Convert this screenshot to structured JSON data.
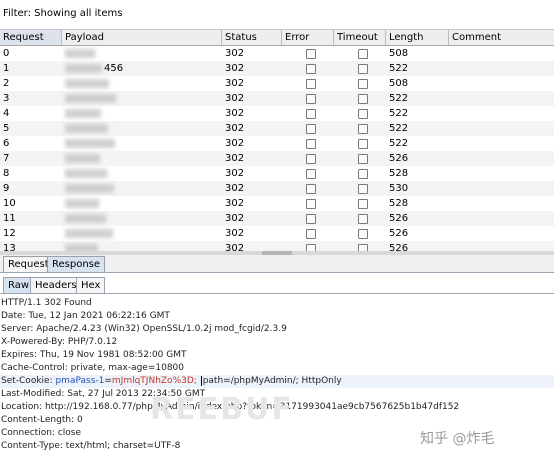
{
  "filter": {
    "label": "Filter: Showing all items"
  },
  "table": {
    "columns": [
      "Request",
      "Payload",
      "Status",
      "Error",
      "Timeout",
      "Length",
      "Comment"
    ],
    "rows": [
      {
        "request": "0",
        "payload": "",
        "status": "302",
        "length": "508",
        "error": false,
        "timeout": false
      },
      {
        "request": "1",
        "payload": "456",
        "status": "302",
        "length": "522",
        "error": false,
        "timeout": false
      },
      {
        "request": "2",
        "payload": "",
        "status": "302",
        "length": "508",
        "error": false,
        "timeout": false
      },
      {
        "request": "3",
        "payload": "",
        "status": "302",
        "length": "522",
        "error": false,
        "timeout": false
      },
      {
        "request": "4",
        "payload": "",
        "status": "302",
        "length": "522",
        "error": false,
        "timeout": false
      },
      {
        "request": "5",
        "payload": "",
        "status": "302",
        "length": "522",
        "error": false,
        "timeout": false
      },
      {
        "request": "6",
        "payload": "",
        "status": "302",
        "length": "522",
        "error": false,
        "timeout": false
      },
      {
        "request": "7",
        "payload": "",
        "status": "302",
        "length": "526",
        "error": false,
        "timeout": false
      },
      {
        "request": "8",
        "payload": "",
        "status": "302",
        "length": "528",
        "error": false,
        "timeout": false
      },
      {
        "request": "9",
        "payload": "",
        "status": "302",
        "length": "530",
        "error": false,
        "timeout": false
      },
      {
        "request": "10",
        "payload": "",
        "status": "302",
        "length": "528",
        "error": false,
        "timeout": false
      },
      {
        "request": "11",
        "payload": "",
        "status": "302",
        "length": "526",
        "error": false,
        "timeout": false
      },
      {
        "request": "12",
        "payload": "",
        "status": "302",
        "length": "526",
        "error": false,
        "timeout": false
      },
      {
        "request": "13",
        "payload": "",
        "status": "302",
        "length": "526",
        "error": false,
        "timeout": false
      }
    ]
  },
  "tabs": {
    "request": "Request",
    "response": "Response"
  },
  "subtabs": {
    "raw": "Raw",
    "headers": "Headers",
    "hex": "Hex"
  },
  "response": {
    "lines": [
      "HTTP/1.1 302 Found",
      "Date: Tue, 12 Jan 2021 06:22:16 GMT",
      "Server: Apache/2.4.23 (Win32) OpenSSL/1.0.2j mod_fcgid/2.3.9",
      "X-Powered-By: PHP/7.0.12",
      "Expires: Thu, 19 Nov 1981 08:52:00 GMT",
      "Cache-Control: private, max-age=10800"
    ],
    "cookie": {
      "prefix": "Set-Cookie: ",
      "name": "pmaPass-1",
      "eq": "=",
      "value": "mJmlqTJNhZo%3D;",
      "suffix": "path=/phpMyAdmin/; HttpOnly"
    },
    "lines2": [
      "Last-Modified: Sat, 27 Jul 2013 22:34:50 GMT",
      "Location: http://192.168.0.77/phpMyAdmin/index.php?token=3171993041ae9cb7567625b1b47df152",
      "Content-Length: 0",
      "Connection: close",
      "Content-Type: text/html; charset=UTF-8"
    ]
  },
  "watermark": {
    "left": "REEBUF",
    "right": "知乎 @炸毛"
  }
}
